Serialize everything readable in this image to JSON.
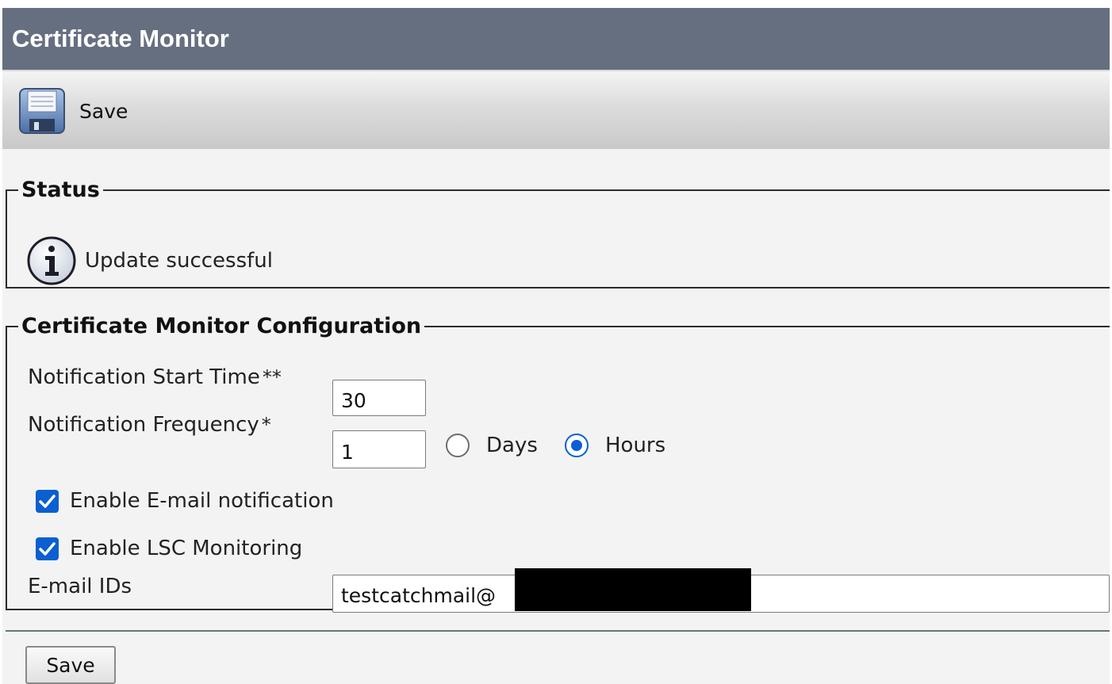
{
  "window": {
    "title": "Certificate Monitor"
  },
  "toolbar": {
    "save_label": "Save",
    "save_icon": "floppy-disk-icon"
  },
  "status": {
    "legend": "Status",
    "icon": "info-icon",
    "message": "Update successful"
  },
  "config": {
    "legend": "Certificate Monitor Configuration",
    "start_time": {
      "label": "Notification Start Time",
      "marker": "**",
      "value": "30"
    },
    "frequency": {
      "label": "Notification Frequency",
      "marker": "*",
      "value": "1",
      "options": [
        {
          "label": "Days",
          "selected": false
        },
        {
          "label": "Hours",
          "selected": true
        }
      ]
    },
    "email_notification": {
      "label": "Enable E-mail notification",
      "checked": true
    },
    "lsc_monitoring": {
      "label": "Enable LSC Monitoring",
      "checked": true
    },
    "email_ids": {
      "label": "E-mail IDs",
      "value": "testcatchmail@"
    }
  },
  "footer": {
    "save_label": "Save"
  },
  "colors": {
    "titlebar": "#666f80",
    "accent": "#0a5fd1",
    "page_background": "#f3f3f3"
  }
}
